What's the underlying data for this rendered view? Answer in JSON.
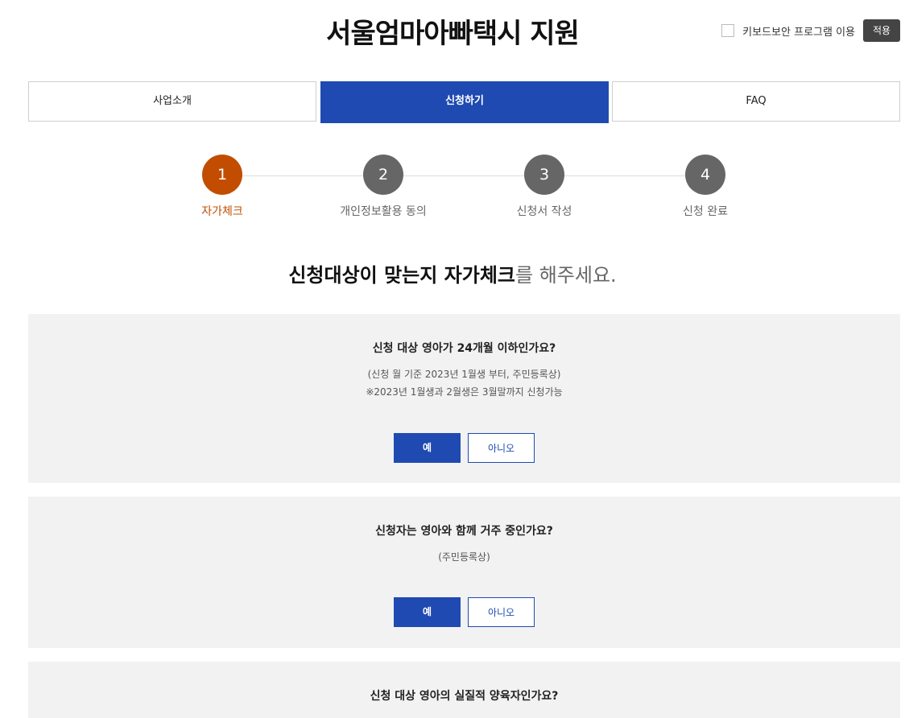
{
  "header": {
    "title": "서울엄마아빠택시 지원",
    "keyboard_security_label": "키보드보안 프로그램 이용",
    "apply_label": "적용"
  },
  "tabs": [
    {
      "label": "사업소개",
      "active": false
    },
    {
      "label": "신청하기",
      "active": true
    },
    {
      "label": "FAQ",
      "active": false
    }
  ],
  "steps": [
    {
      "number": "1",
      "label": "자가체크",
      "active": true
    },
    {
      "number": "2",
      "label": "개인정보활용 동의",
      "active": false
    },
    {
      "number": "3",
      "label": "신청서 작성",
      "active": false
    },
    {
      "number": "4",
      "label": "신청 완료",
      "active": false
    }
  ],
  "headline": {
    "strong": "신청대상이 맞는지 자가체크",
    "rest": "를 해주세요."
  },
  "questions": [
    {
      "title": "신청 대상 영아가 24개월 이하인가요?",
      "desc": [
        "(신청 월 기준 2023년 1월생 부터, 주민등록상)",
        "※2023년 1월생과 2월생은 3월말까지 신청가능"
      ],
      "yes": "예",
      "no": "아니오"
    },
    {
      "title": "신청자는 영아와 함께 거주 중인가요?",
      "desc": [
        "(주민등록상)"
      ],
      "yes": "예",
      "no": "아니오"
    },
    {
      "title": "신청 대상 영아의 실질적 양육자인가요?"
    }
  ],
  "colors": {
    "primary": "#1f4ab1",
    "step_active": "#c24d00",
    "step_inactive": "#666666",
    "box_bg": "#f2f2f3"
  }
}
